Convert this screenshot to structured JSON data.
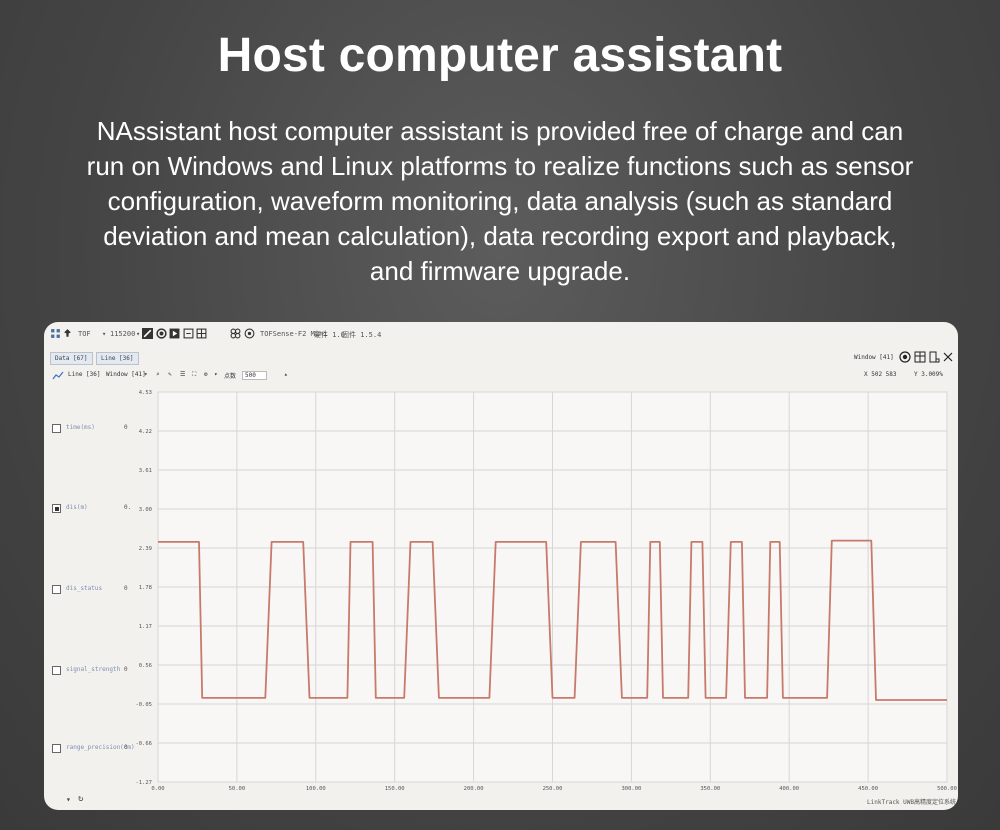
{
  "headline": "Host computer assistant",
  "description_lines": [
    "NAssistant host computer assistant is provided free of charge and can",
    "run on Windows and Linux platforms to realize functions such as sensor",
    "configuration, waveform monitoring, data analysis (such as standard",
    "deviation and mean calculation), data recording export and playback,",
    "and firmware upgrade."
  ],
  "app": {
    "toolbar": {
      "port": "TOF",
      "baud": "115200",
      "device": "TOFSense-F2 Mini",
      "version_a": "硬件 1.0",
      "version_b": "固件 1.5.4"
    },
    "tabs": [
      "Data [67]",
      "Line [36]"
    ],
    "chart_toolbar": {
      "line_label": "Line [36]",
      "window_label": "Window [41]",
      "points_label": "点数",
      "points_value": "500",
      "right_window": "Window [41]",
      "x_readout": "X 502 583",
      "y_readout": "Y 3.009%"
    },
    "channels": [
      {
        "label": "time(ms)",
        "value": "0",
        "checked": false
      },
      {
        "label": "dis(m)",
        "value": "0.",
        "checked": true
      },
      {
        "label": "dis_status",
        "value": "0",
        "checked": false
      },
      {
        "label": "signal_strength",
        "value": "0",
        "checked": false
      },
      {
        "label": "range_precision(cm)",
        "value": "0",
        "checked": false
      }
    ],
    "footer": "LinkTrack UWB高精度定位系统",
    "colors": {
      "trace": "#c87a6a",
      "grid": "#d6d6d6",
      "window_bg": "#f3f1ee",
      "plot_bg": "#f8f7f5"
    }
  },
  "chart_data": {
    "type": "line",
    "xlim": [
      0,
      500
    ],
    "ylim": [
      -1.27,
      4.53
    ],
    "x_ticks": [
      "0.00",
      "50.00",
      "100.00",
      "150.00",
      "200.00",
      "250.00",
      "300.00",
      "350.00",
      "400.00",
      "450.00",
      "500.00"
    ],
    "y_ticks": [
      "4.53",
      "4.22",
      "3.61",
      "3.00",
      "2.39",
      "1.78",
      "1.17",
      "0.56",
      "-0.05",
      "-0.66",
      "-1.27"
    ],
    "series": [
      {
        "x": [
          0,
          26,
          28,
          68,
          72,
          92,
          96,
          120,
          122,
          136,
          138,
          156,
          160,
          174,
          178,
          210,
          214,
          246,
          250,
          264,
          268,
          290,
          294,
          310,
          312,
          318,
          320,
          336,
          338,
          345,
          347,
          360,
          363,
          370,
          372,
          386,
          388,
          394,
          396,
          424,
          427,
          452,
          455,
          500
        ],
        "y": [
          2.3,
          2.3,
          -0.02,
          -0.02,
          2.3,
          2.3,
          -0.02,
          -0.02,
          2.3,
          2.3,
          -0.02,
          -0.02,
          2.3,
          2.3,
          -0.02,
          -0.02,
          2.3,
          2.3,
          -0.02,
          -0.02,
          2.3,
          2.3,
          -0.02,
          -0.02,
          2.3,
          2.3,
          -0.02,
          -0.02,
          2.3,
          2.3,
          -0.02,
          -0.02,
          2.3,
          2.3,
          -0.02,
          -0.02,
          2.3,
          2.3,
          -0.02,
          -0.02,
          2.32,
          2.32,
          -0.05,
          -0.05
        ]
      }
    ]
  }
}
